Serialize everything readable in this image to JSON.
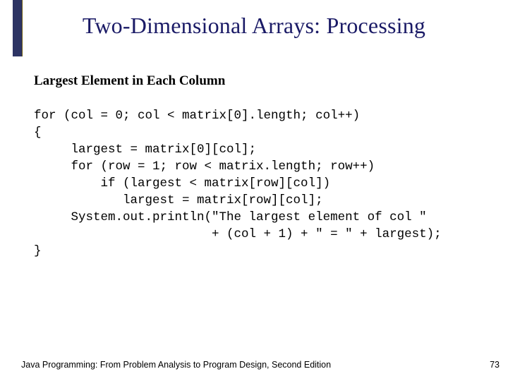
{
  "title": "Two-Dimensional Arrays: Processing",
  "subtitle": "Largest Element in Each Column",
  "code": "for (col = 0; col < matrix[0].length; col++)\n{\n     largest = matrix[0][col];\n     for (row = 1; row < matrix.length; row++)\n         if (largest < matrix[row][col])\n            largest = matrix[row][col];\n     System.out.println(\"The largest element of col \"\n                        + (col + 1) + \" = \" + largest);\n}",
  "footer_left": "Java Programming: From Problem Analysis to Program Design, Second Edition",
  "page_number": "73"
}
